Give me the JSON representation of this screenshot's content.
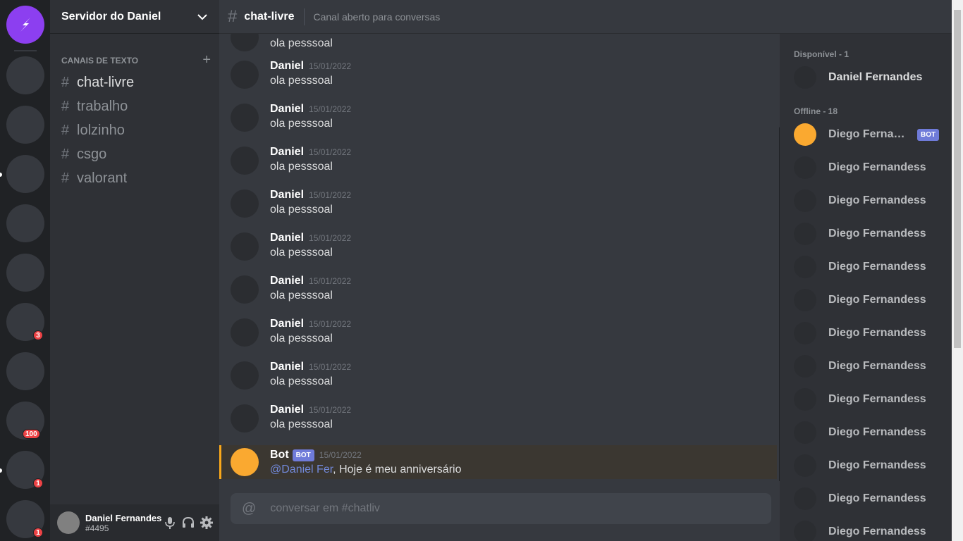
{
  "server": {
    "name": "Servidor do Daniel",
    "badges": [
      "3",
      "100",
      "1",
      "1"
    ]
  },
  "sidebar": {
    "category": "CANAIS DE TEXTO",
    "channels": [
      "chat-livre",
      "trabalho",
      "lolzinho",
      "csgo",
      "valorant"
    ]
  },
  "user": {
    "name": "Daniel Fernandes",
    "tag": "#4495"
  },
  "chat": {
    "title": "chat-livre",
    "topic": "Canal aberto para conversas",
    "first_text": "ola pesssoal",
    "messages": [
      {
        "author": "Daniel",
        "time": "15/01/2022",
        "text": "ola pesssoal"
      },
      {
        "author": "Daniel",
        "time": "15/01/2022",
        "text": "ola pesssoal"
      },
      {
        "author": "Daniel",
        "time": "15/01/2022",
        "text": "ola pesssoal"
      },
      {
        "author": "Daniel",
        "time": "15/01/2022",
        "text": "ola pesssoal"
      },
      {
        "author": "Daniel",
        "time": "15/01/2022",
        "text": "ola pesssoal"
      },
      {
        "author": "Daniel",
        "time": "15/01/2022",
        "text": "ola pesssoal"
      },
      {
        "author": "Daniel",
        "time": "15/01/2022",
        "text": "ola pesssoal"
      },
      {
        "author": "Daniel",
        "time": "15/01/2022",
        "text": "ola pesssoal"
      },
      {
        "author": "Daniel",
        "time": "15/01/2022",
        "text": "ola pesssoal"
      }
    ],
    "bot_message": {
      "author": "Bot",
      "tag": "BOT",
      "time": "15/01/2022",
      "mention": "@Daniel Fer",
      "text": ", Hoje é meu anniversário"
    },
    "composer_placeholder": "conversar em #chatliv"
  },
  "members": {
    "online_header": "Disponível - 1",
    "online": [
      "Daniel Fernandes"
    ],
    "offline_header": "Offline - 18",
    "bot_member": {
      "name": "Diego Fernandess",
      "tag": "BOT"
    },
    "offline": [
      "Diego Fernandess",
      "Diego Fernandess",
      "Diego Fernandess",
      "Diego Fernandess",
      "Diego Fernandess",
      "Diego Fernandess",
      "Diego Fernandess",
      "Diego Fernandess",
      "Diego Fernandess",
      "Diego Fernandess",
      "Diego Fernandess",
      "Diego Fernandess"
    ]
  },
  "colors": {
    "accent": "#8c3ff0",
    "mention_bar": "#faa81a",
    "bot_tag": "#6f7bd9",
    "badge": "#ed4245"
  }
}
